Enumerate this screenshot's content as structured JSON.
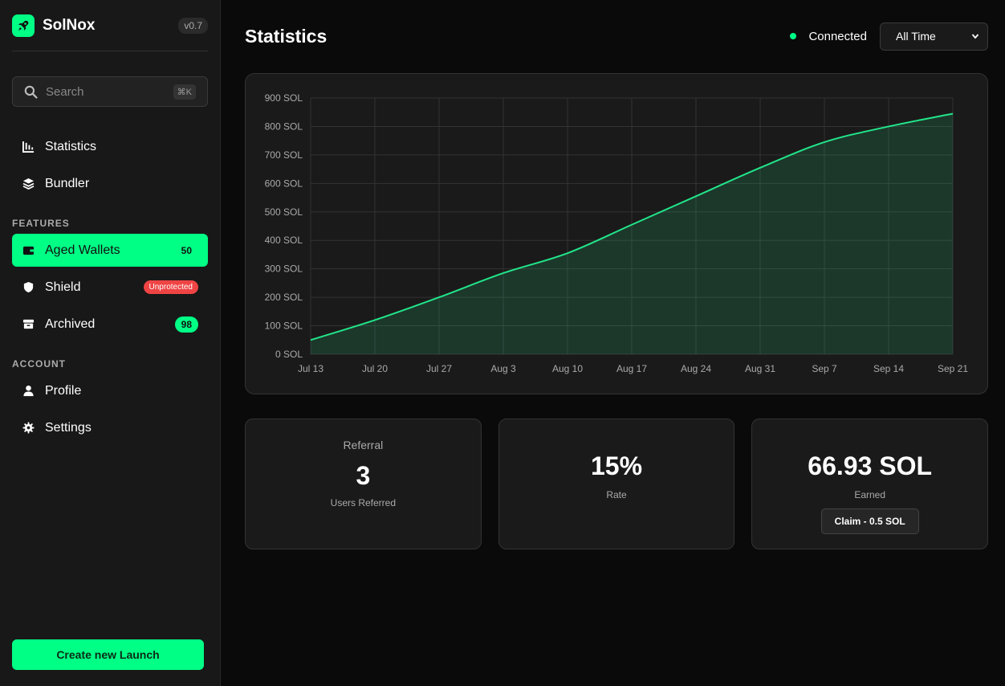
{
  "app": {
    "name": "SolNox",
    "version": "v0.7"
  },
  "search": {
    "placeholder": "Search",
    "shortcut": "⌘K"
  },
  "nav": {
    "main": [
      {
        "label": "Statistics",
        "icon": "chart-bar-icon"
      },
      {
        "label": "Bundler",
        "icon": "layers-icon"
      }
    ],
    "features_label": "FEATURES",
    "features": [
      {
        "label": "Aged Wallets",
        "icon": "wallet-icon",
        "badge": "50",
        "active": true
      },
      {
        "label": "Shield",
        "icon": "shield-icon",
        "badge": "Unprotected"
      },
      {
        "label": "Archived",
        "icon": "archive-icon",
        "badge": "98"
      }
    ],
    "account_label": "ACCOUNT",
    "account": [
      {
        "label": "Profile",
        "icon": "user-icon"
      },
      {
        "label": "Settings",
        "icon": "gear-icon"
      }
    ],
    "create_label": "Create new Launch"
  },
  "header": {
    "title": "Statistics",
    "status": "Connected",
    "range": "All Time"
  },
  "colors": {
    "accent": "#00ff85",
    "danger": "#ef4444",
    "background": "#0a0a0a",
    "panel": "#1a1a1a"
  },
  "chart_data": {
    "type": "area",
    "x": [
      "Jul 13",
      "Jul 20",
      "Jul 27",
      "Aug 3",
      "Aug 10",
      "Aug 17",
      "Aug 24",
      "Aug 31",
      "Sep 7",
      "Sep 14",
      "Sep 21"
    ],
    "values": [
      50,
      120,
      200,
      285,
      355,
      455,
      555,
      655,
      745,
      800,
      845
    ],
    "y_ticks": [
      "0 SOL",
      "100 SOL",
      "200 SOL",
      "300 SOL",
      "400 SOL",
      "500 SOL",
      "600 SOL",
      "700 SOL",
      "800 SOL",
      "900 SOL"
    ],
    "ylim": [
      0,
      900
    ],
    "grid": true,
    "color": "#22e58a"
  },
  "cards": {
    "referral": {
      "caption": "Referral",
      "value": "3",
      "label": "Users Referred"
    },
    "rate": {
      "value": "15%",
      "label": "Rate"
    },
    "earned": {
      "value": "66.93 SOL",
      "label": "Earned",
      "button": "Claim - 0.5 SOL"
    }
  }
}
